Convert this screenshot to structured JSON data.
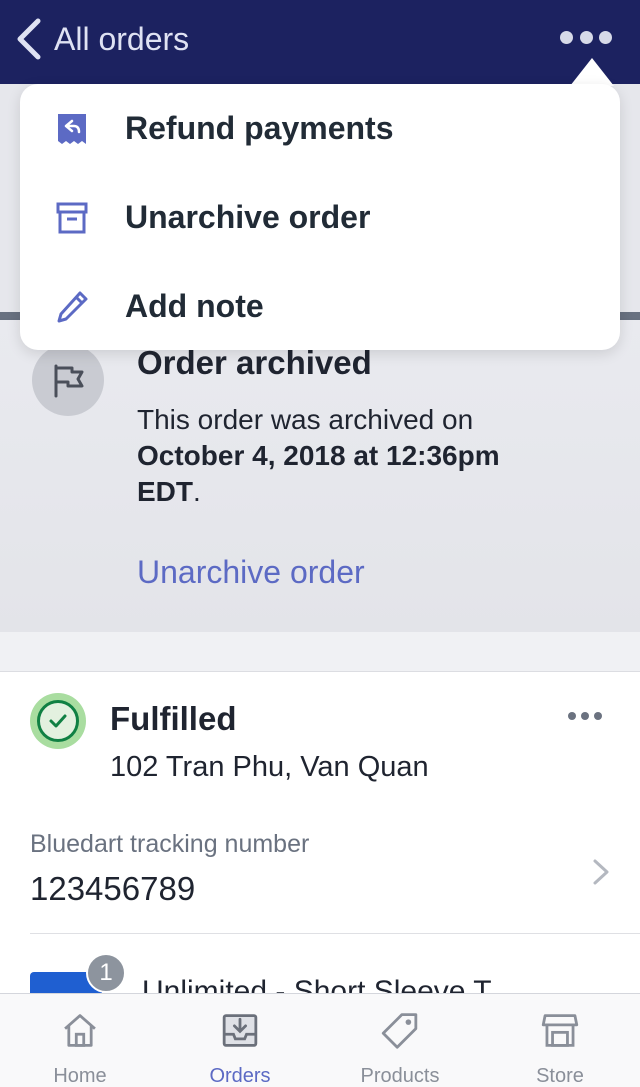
{
  "header": {
    "back_label": "All orders",
    "background": "#1c2260"
  },
  "menu": {
    "items": [
      {
        "label": "Refund payments",
        "icon": "receipt-refund-icon"
      },
      {
        "label": "Unarchive order",
        "icon": "archive-icon"
      },
      {
        "label": "Add note",
        "icon": "pencil-icon"
      }
    ]
  },
  "archived": {
    "title": "Order archived",
    "text_prefix": "This order was archived on",
    "date": "October 4, 2018 at 12:36pm",
    "tz": "EDT",
    "tz_suffix": ".",
    "link": "Unarchive order",
    "icon": "flag-icon"
  },
  "fulfillment": {
    "status": "Fulfilled",
    "address": "102 Tran Phu, Van Quan",
    "tracking_label": "Bluedart tracking number",
    "tracking_number": "123456789",
    "status_color": "#108043"
  },
  "product": {
    "quantity": "1",
    "name": "Unlimited - Short Sleeve T"
  },
  "tabs": [
    {
      "label": "Home",
      "icon": "home-icon",
      "active": false
    },
    {
      "label": "Orders",
      "icon": "orders-inbox-icon",
      "active": true
    },
    {
      "label": "Products",
      "icon": "tag-icon",
      "active": false
    },
    {
      "label": "Store",
      "icon": "store-icon",
      "active": false
    }
  ],
  "colors": {
    "accent": "#5c6ac4",
    "text": "#212b36",
    "muted": "#8a8f99"
  }
}
